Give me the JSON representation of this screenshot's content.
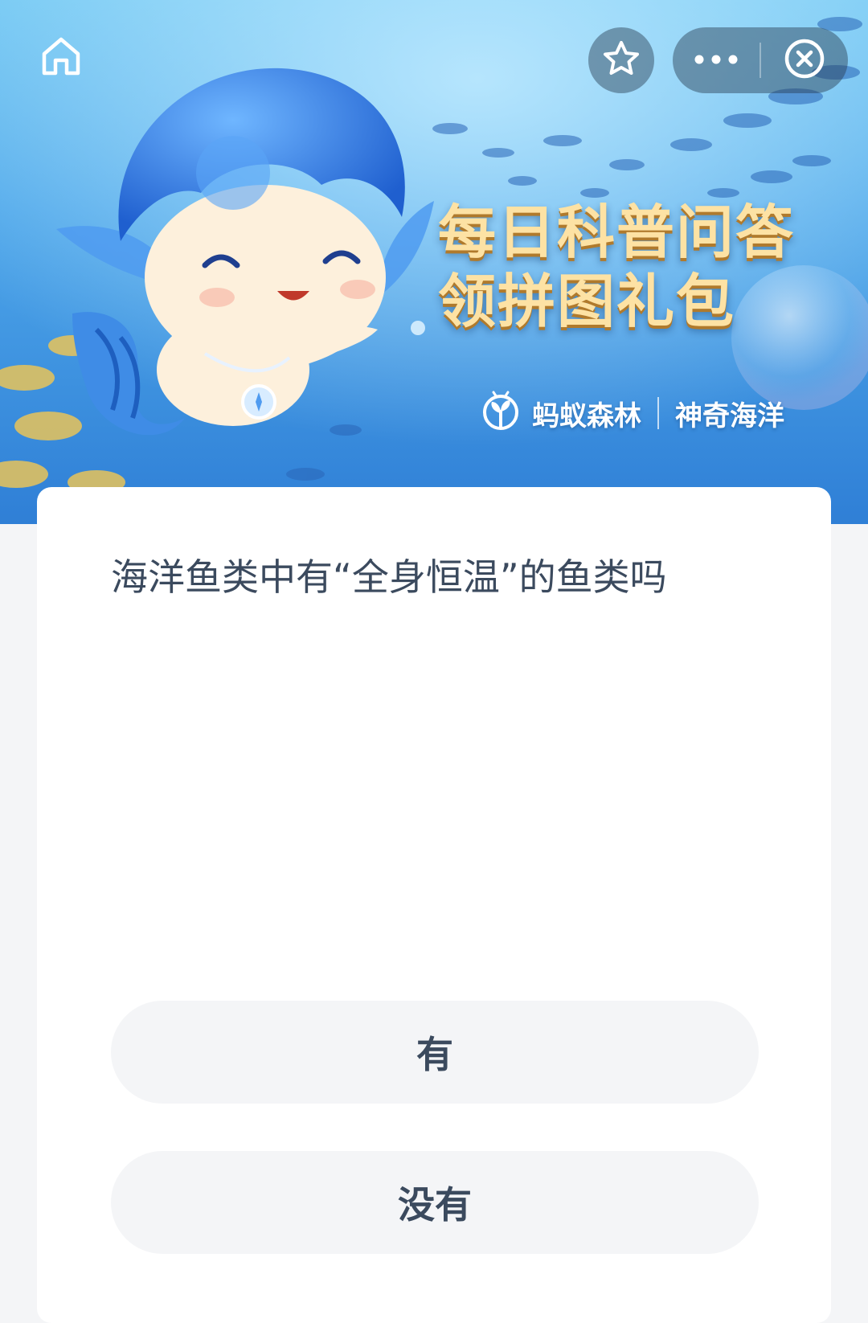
{
  "navbar": {
    "home_icon": "home-icon",
    "favorite_icon": "star-icon",
    "more_icon": "more-dots-icon",
    "close_icon": "close-circle-icon"
  },
  "banner": {
    "title_line1": "每日科普问答",
    "title_line2": "领拼图礼包",
    "brand_left": "蚂蚁森林",
    "brand_right": "神奇海洋",
    "brand_icon": "ant-forest-sprout-icon"
  },
  "quiz": {
    "question": "海洋鱼类中有“全身恒温”的鱼类吗",
    "options": [
      {
        "label": "有"
      },
      {
        "label": "没有"
      }
    ]
  },
  "colors": {
    "banner_top": "#6fc6f2",
    "banner_bottom": "#2f7fd6",
    "title_gold": "#fde2a4",
    "text": "#3b4a5e",
    "page_bg": "#f4f5f7"
  }
}
